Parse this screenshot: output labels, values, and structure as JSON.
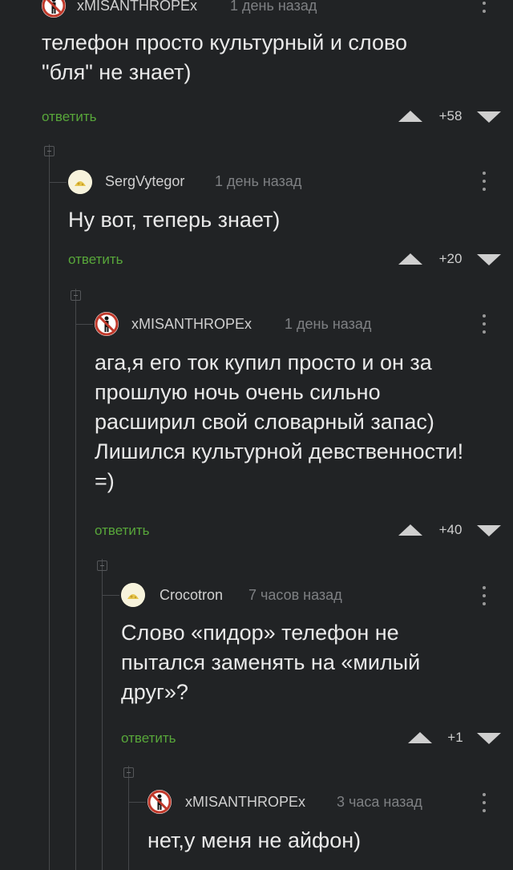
{
  "comments": [
    {
      "author": "xMISANTHROPEx",
      "time": "1 день назад",
      "avatar_icon": "no-entry-man-icon",
      "text": "телефон просто культурный и слово \"бля\" не знает)",
      "reply_label": "ответить",
      "rating": "+58"
    },
    {
      "author": "SergVytegor",
      "time": "1 день назад",
      "avatar_icon": "default-avatar-icon",
      "text": "Ну вот, теперь знает)",
      "reply_label": "ответить",
      "rating": "+20"
    },
    {
      "author": "xMISANTHROPEx",
      "time": "1 день назад",
      "avatar_icon": "no-entry-man-icon",
      "text": "ага,я его ток купил просто и он за прошлую ночь очень сильно расширил свой словарный запас) Лишился культурной девственности! =)",
      "reply_label": "ответить",
      "rating": "+40"
    },
    {
      "author": "Crocotron",
      "time": "7 часов назад",
      "avatar_icon": "default-avatar-icon",
      "text": "Слово «пидор» телефон не пытался заменять на «милый друг»?",
      "reply_label": "ответить",
      "rating": "+1"
    },
    {
      "author": "xMISANTHROPEx",
      "time": "3 часа назад",
      "avatar_icon": "no-entry-man-icon",
      "text": "нет,у меня не айфон)"
    }
  ],
  "colors": {
    "background": "#212325",
    "reply_link": "#58a73a",
    "meta_text": "#7e8083"
  }
}
